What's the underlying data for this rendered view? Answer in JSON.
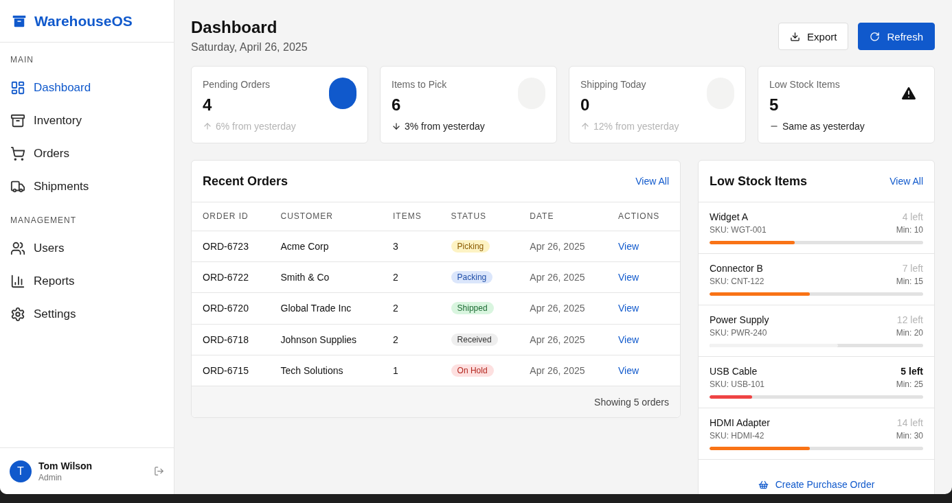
{
  "brand": {
    "name": "WarehouseOS"
  },
  "sidebar": {
    "sections": [
      {
        "title": "MAIN",
        "items": [
          {
            "label": "Dashboard",
            "selected": true
          },
          {
            "label": "Inventory",
            "selected": false
          },
          {
            "label": "Orders",
            "selected": false
          },
          {
            "label": "Shipments",
            "selected": false
          }
        ]
      },
      {
        "title": "MANAGEMENT",
        "items": [
          {
            "label": "Users",
            "selected": false
          },
          {
            "label": "Reports",
            "selected": false
          },
          {
            "label": "Settings",
            "selected": false
          }
        ]
      }
    ]
  },
  "user": {
    "initial": "T",
    "name": "Tom Wilson",
    "role": "Admin"
  },
  "header": {
    "title": "Dashboard",
    "date": "Saturday, April 26, 2025",
    "buttons": [
      {
        "label": "Export",
        "kind": "secondary"
      },
      {
        "label": "Refresh",
        "kind": "primary"
      }
    ]
  },
  "stats": [
    {
      "label": "Pending Orders",
      "value": "4",
      "badge": {
        "kind": "circle",
        "color": "#1059cc"
      },
      "trend": {
        "kind": "up",
        "text": "6% from yesterday",
        "faded": true
      }
    },
    {
      "label": "Items to Pick",
      "value": "6",
      "badge": {
        "kind": "circle",
        "color": "#f3f3f2"
      },
      "trend": {
        "kind": "down",
        "text": "3% from yesterday",
        "faded": false
      }
    },
    {
      "label": "Shipping Today",
      "value": "0",
      "badge": {
        "kind": "circle",
        "color": "#f3f3f2"
      },
      "trend": {
        "kind": "up",
        "text": "12% from yesterday",
        "faded": true
      }
    },
    {
      "label": "Low Stock Items",
      "value": "5",
      "badge": {
        "kind": "warning"
      },
      "trend": {
        "kind": "flat",
        "text": "Same as yesterday",
        "faded": false
      }
    }
  ],
  "recent_orders": {
    "title": "Recent Orders",
    "link": "View All",
    "columns": [
      "ORDER ID",
      "CUSTOMER",
      "ITEMS",
      "STATUS",
      "DATE",
      "ACTIONS"
    ],
    "rows": [
      {
        "id": "ORD-6723",
        "customer": "Acme Corp",
        "items": "3",
        "status": {
          "kind": "picking",
          "label": "Picking"
        },
        "date": "Apr 26, 2025",
        "action": "View"
      },
      {
        "id": "ORD-6722",
        "customer": "Smith & Co",
        "items": "2",
        "status": {
          "kind": "packing",
          "label": "Packing"
        },
        "date": "Apr 26, 2025",
        "action": "View"
      },
      {
        "id": "ORD-6720",
        "customer": "Global Trade Inc",
        "items": "2",
        "status": {
          "kind": "shipped",
          "label": "Shipped"
        },
        "date": "Apr 26, 2025",
        "action": "View"
      },
      {
        "id": "ORD-6718",
        "customer": "Johnson Supplies",
        "items": "2",
        "status": {
          "kind": "received",
          "label": "Received"
        },
        "date": "Apr 26, 2025",
        "action": "View"
      },
      {
        "id": "ORD-6715",
        "customer": "Tech Solutions",
        "items": "1",
        "status": {
          "kind": "hold",
          "label": "On Hold"
        },
        "date": "Apr 26, 2025",
        "action": "View"
      }
    ],
    "footer": "Showing 5 orders"
  },
  "low_stock": {
    "title": "Low Stock Items",
    "link": "View All",
    "items": [
      {
        "name": "Widget A",
        "sku": "SKU: WGT-001",
        "qty": "4 left",
        "min": "Min: 10",
        "level": 0.4,
        "kind": "low"
      },
      {
        "name": "Connector B",
        "sku": "SKU: CNT-122",
        "qty": "7 left",
        "min": "Min: 15",
        "level": 0.47,
        "kind": "low"
      },
      {
        "name": "Power Supply",
        "sku": "SKU: PWR-240",
        "qty": "12 left",
        "min": "Min: 20",
        "level": 0.6,
        "kind": "ok"
      },
      {
        "name": "USB Cable",
        "sku": "SKU: USB-101",
        "qty": "5 left",
        "min": "Min: 25",
        "level": 0.2,
        "kind": "critical"
      },
      {
        "name": "HDMI Adapter",
        "sku": "SKU: HDMI-42",
        "qty": "14 left",
        "min": "Min: 30",
        "level": 0.47,
        "kind": "low"
      }
    ],
    "action": "Create Purchase Order"
  }
}
